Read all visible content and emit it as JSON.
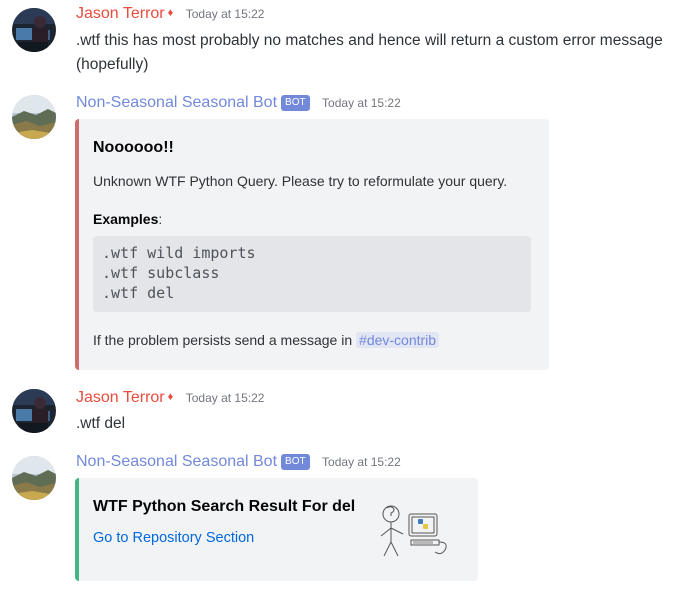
{
  "messages": [
    {
      "author": "Jason Terror",
      "role_icon": "diamond-icon",
      "timestamp": "Today at 15:22",
      "content": ".wtf this has most probably no matches and hence will return a custom error message (hopefully)"
    },
    {
      "author": "Non-Seasonal Seasonal Bot",
      "bot_tag": "BOT",
      "timestamp": "Today at 15:22",
      "embed": {
        "accent_color": "#cd6d6d",
        "title": "Noooooo!!",
        "description": "Unknown WTF Python Query. Please try to reformulate your query.",
        "examples_label": "Examples",
        "examples_suffix": ":",
        "code_lines": [
          ".wtf wild imports",
          ".wtf subclass",
          ".wtf del"
        ],
        "footer_prefix": "If the problem persists send a message in ",
        "channel": "#dev-contrib"
      }
    },
    {
      "author": "Jason Terror",
      "role_icon": "diamond-icon",
      "timestamp": "Today at 15:22",
      "content": ".wtf del"
    },
    {
      "author": "Non-Seasonal Seasonal Bot",
      "bot_tag": "BOT",
      "timestamp": "Today at 15:22",
      "embed": {
        "accent_color": "#43b581",
        "title": "WTF Python Search Result For del",
        "link_text": "Go to Repository Section",
        "thumbnail": "stick-figure-python-computer-illustration"
      }
    }
  ]
}
